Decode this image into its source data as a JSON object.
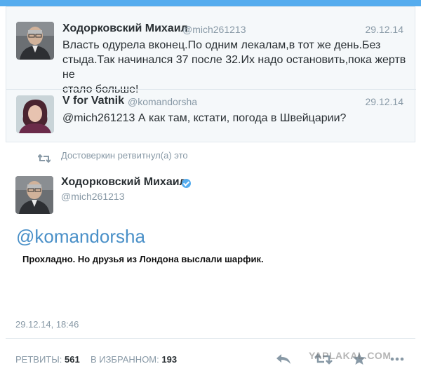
{
  "thread": {
    "tweet1": {
      "name": "Ходорковский Михаил",
      "handle": "@mich261213",
      "date": "29.12.14",
      "text_line1": "Власть одурела вконец.По одним лекалам,в тот же день.Без",
      "text_line2": "стыда.Так начинался 37 после 32.Их надо остановить,пока жертв не",
      "text_line3": "стало больше!"
    },
    "tweet2": {
      "name": "V for Vatnik",
      "handle": "@komandorsha",
      "date": "29.12.14",
      "text": "@mich261213 А как там, кстати, погода в Швейцарии?"
    }
  },
  "focus": {
    "retweet_line": "Достоверкин ретвитнул(а) это",
    "name": "Ходорковский Михаил",
    "handle": "@mich261213",
    "mention": "@komandorsha",
    "reply_text": "Прохладно. Но друзья из Лондона выслали шарфик.",
    "time": "29.12.14, 18:46",
    "retweets_label": "РЕТВИТЫ:",
    "retweets_count": "561",
    "favorites_label": "В ИЗБРАННОМ:",
    "favorites_count": "193"
  },
  "watermark": "YAPLAKAL.COM",
  "icons": [
    "retweet-icon",
    "verified-badge-icon",
    "reply-icon",
    "retweet-action-icon",
    "favorite-icon",
    "more-icon"
  ],
  "colors": {
    "accent": "#55acee",
    "text": "#292f33",
    "muted": "#8899a6"
  }
}
